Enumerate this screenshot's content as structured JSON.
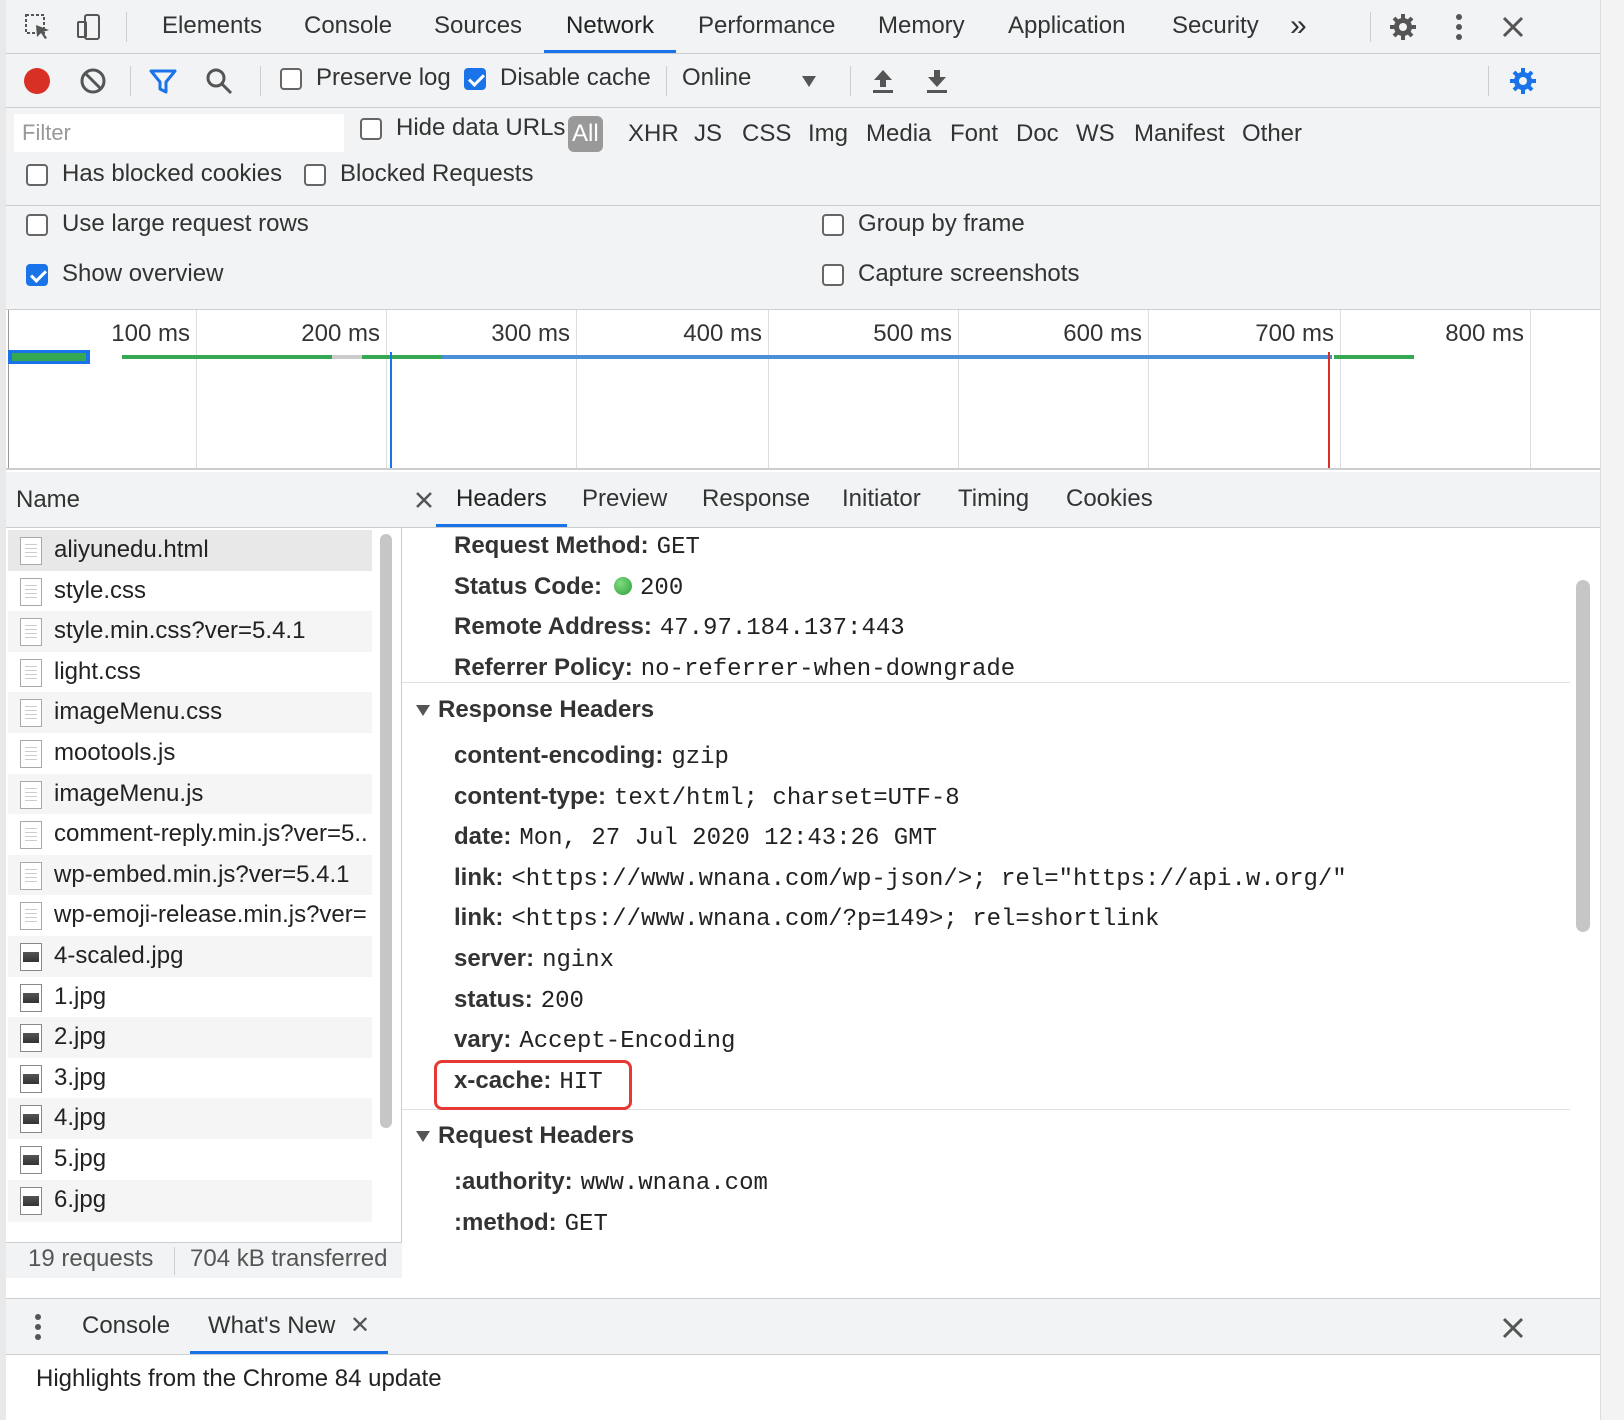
{
  "main_tabs": [
    "Elements",
    "Console",
    "Sources",
    "Network",
    "Performance",
    "Memory",
    "Application",
    "Security"
  ],
  "main_tabs_active": "Network",
  "more_tabs_symbol": "»",
  "toolbar": {
    "preserve_log": {
      "label": "Preserve log",
      "checked": false
    },
    "disable_cache": {
      "label": "Disable cache",
      "checked": true
    },
    "throttling": "Online"
  },
  "filter": {
    "placeholder": "Filter",
    "hide_data_urls": "Hide data URLs",
    "types": [
      "All",
      "XHR",
      "JS",
      "CSS",
      "Img",
      "Media",
      "Font",
      "Doc",
      "WS",
      "Manifest",
      "Other"
    ],
    "selected_type": "All",
    "has_blocked_cookies": "Has blocked cookies",
    "blocked_requests": "Blocked Requests"
  },
  "settings": {
    "use_large_rows": {
      "label": "Use large request rows",
      "checked": false
    },
    "show_overview": {
      "label": "Show overview",
      "checked": true
    },
    "group_by_frame": {
      "label": "Group by frame",
      "checked": false
    },
    "capture_screenshots": {
      "label": "Capture screenshots",
      "checked": false
    }
  },
  "overview": {
    "ticks": [
      "100 ms",
      "200 ms",
      "300 ms",
      "400 ms",
      "500 ms",
      "600 ms",
      "700 ms",
      "800 ms"
    ],
    "dom_content_loaded_ms": 200,
    "load_ms": 705
  },
  "request_list": {
    "header": "Name",
    "rows": [
      {
        "name": "aliyunedu.html",
        "type": "doc"
      },
      {
        "name": "style.css",
        "type": "doc"
      },
      {
        "name": "style.min.css?ver=5.4.1",
        "type": "doc"
      },
      {
        "name": "light.css",
        "type": "doc"
      },
      {
        "name": "imageMenu.css",
        "type": "doc"
      },
      {
        "name": "mootools.js",
        "type": "doc"
      },
      {
        "name": "imageMenu.js",
        "type": "doc"
      },
      {
        "name": "comment-reply.min.js?ver=5..",
        "type": "doc"
      },
      {
        "name": "wp-embed.min.js?ver=5.4.1",
        "type": "doc"
      },
      {
        "name": "wp-emoji-release.min.js?ver=",
        "type": "doc"
      },
      {
        "name": "4-scaled.jpg",
        "type": "img"
      },
      {
        "name": "1.jpg",
        "type": "img"
      },
      {
        "name": "2.jpg",
        "type": "img"
      },
      {
        "name": "3.jpg",
        "type": "img"
      },
      {
        "name": "4.jpg",
        "type": "img"
      },
      {
        "name": "5.jpg",
        "type": "img"
      },
      {
        "name": "6.jpg",
        "type": "img"
      }
    ],
    "status_requests": "19 requests",
    "status_transferred": "704 kB transferred"
  },
  "detail_tabs": [
    "Headers",
    "Preview",
    "Response",
    "Initiator",
    "Timing",
    "Cookies"
  ],
  "detail_tabs_active": "Headers",
  "general": [
    {
      "k": "Request Method:",
      "v": "GET"
    },
    {
      "k": "Status Code:",
      "v": "200"
    },
    {
      "k": "Remote Address:",
      "v": "47.97.184.137:443"
    },
    {
      "k": "Referrer Policy:",
      "v": "no-referrer-when-downgrade"
    }
  ],
  "response_headers_title": "Response Headers",
  "response_headers": [
    {
      "k": "content-encoding:",
      "v": "gzip"
    },
    {
      "k": "content-type:",
      "v": "text/html; charset=UTF-8"
    },
    {
      "k": "date:",
      "v": "Mon, 27 Jul 2020 12:43:26 GMT"
    },
    {
      "k": "link:",
      "v": "<https://www.wnana.com/wp-json/>; rel=\"https://api.w.org/\""
    },
    {
      "k": "link:",
      "v": "<https://www.wnana.com/?p=149>; rel=shortlink"
    },
    {
      "k": "server:",
      "v": "nginx"
    },
    {
      "k": "status:",
      "v": "200"
    },
    {
      "k": "vary:",
      "v": "Accept-Encoding"
    },
    {
      "k": "x-cache:",
      "v": "HIT"
    }
  ],
  "request_headers_title": "Request Headers",
  "request_headers": [
    {
      "k": ":authority:",
      "v": "www.wnana.com"
    },
    {
      "k": ":method:",
      "v": "GET"
    }
  ],
  "drawer": {
    "tabs": [
      "Console",
      "What's New"
    ],
    "active": "What's New",
    "content": "Highlights from the Chrome 84 update"
  },
  "colors": {
    "accent": "#1a73e8",
    "record": "#d93025",
    "status_ok": "#34a853",
    "highlight_box": "#e53935"
  }
}
